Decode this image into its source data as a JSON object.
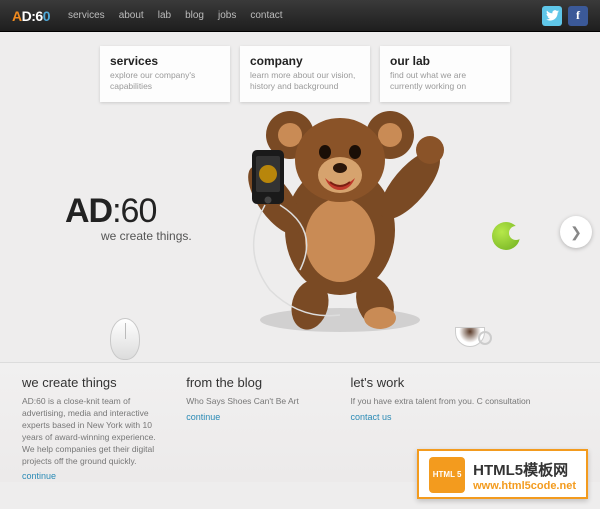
{
  "nav": {
    "items": [
      "services",
      "about",
      "lab",
      "blog",
      "jobs",
      "contact"
    ]
  },
  "cards": [
    {
      "title": "services",
      "desc": "explore our company's capabilities"
    },
    {
      "title": "company",
      "desc": "learn more about our vision, history and background"
    },
    {
      "title": "our lab",
      "desc": "find out what we are currently working on"
    }
  ],
  "brand": {
    "name_a": "AD",
    "name_b": ":60",
    "tagline": "we create things."
  },
  "columns": {
    "create": {
      "title": "we create things",
      "body": "AD:60 is a close-knit team of advertising, media and interactive experts based in New York with 10 years of award-winning experience. We help companies get their digital projects off the ground quickly.",
      "link": "continue"
    },
    "blog": {
      "title": "from the blog",
      "body": "Who Says Shoes Can't Be Art",
      "link": "continue"
    },
    "work": {
      "title": "let's work",
      "body": "If you have extra talent from you. C consultation",
      "link": "contact us"
    }
  },
  "watermark": {
    "badge": "HTML 5",
    "title": "HTML5模板网",
    "url": "www.html5code.net"
  }
}
